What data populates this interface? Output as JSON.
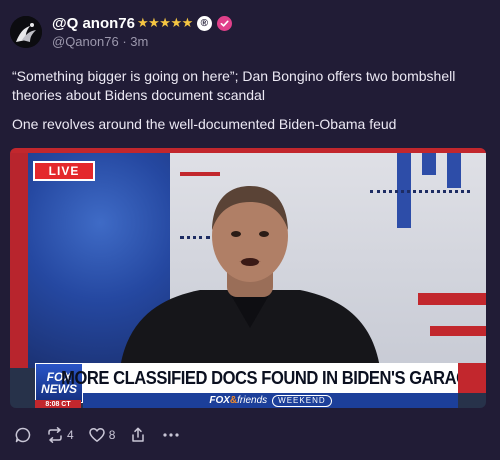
{
  "author": {
    "display_name": "@Q anon76",
    "stars": "★★★★★",
    "reg_mark": "®",
    "handle": "@Qanon76",
    "separator": "·",
    "time": "3m"
  },
  "post": {
    "paragraphs": [
      "“Something bigger is going on here”; Dan Bongino offers two bombshell theories about Bidens document scandal",
      "One revolves around the well-documented Biden-Obama feud"
    ]
  },
  "media": {
    "live_label": "LIVE",
    "fox_logo_line1": "FOX",
    "fox_logo_line2": "NEWS",
    "fox_time": "8:08 CT",
    "chyron": "MORE CLASSIFIED DOCS FOUND IN BIDEN'S GARAGE",
    "show_brand": "FOX",
    "show_amp": "&",
    "show_name": "friends",
    "show_weekend": "WEEKEND"
  },
  "actions": {
    "reply_icon": "comment-icon",
    "repost_icon": "repost-icon",
    "repost_count": "4",
    "like_icon": "heart-icon",
    "like_count": "8",
    "share_icon": "share-icon",
    "more_icon": "more-icon"
  },
  "colors": {
    "background": "#211c36",
    "star": "#f5c542",
    "verified": "#e0408a",
    "fox_red": "#c2272d",
    "fox_blue": "#1c3f9a"
  }
}
